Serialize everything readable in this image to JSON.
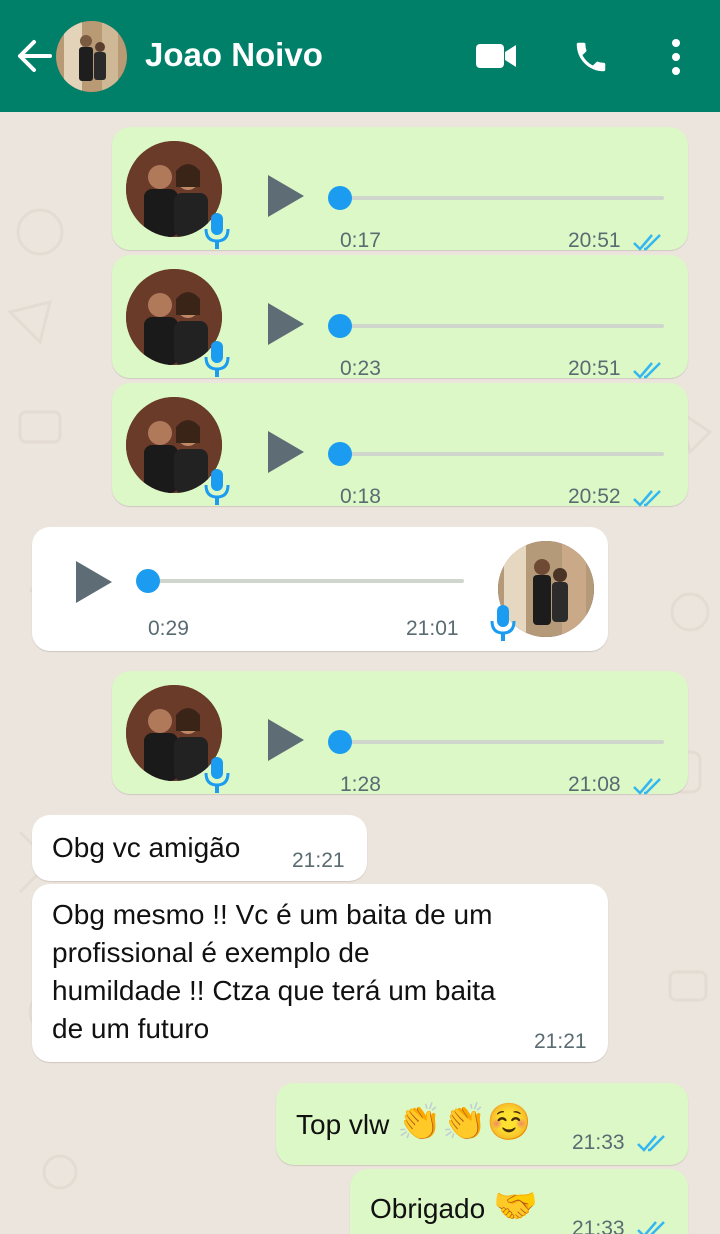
{
  "header": {
    "contact_name": "Joao Noivo",
    "bg_color": "#008069",
    "icons": [
      "back-arrow-icon",
      "video-call-icon",
      "phone-icon",
      "more-options-icon"
    ]
  },
  "messages": [
    {
      "type": "voice",
      "direction": "out",
      "duration": "0:17",
      "time": "20:51",
      "status": "read"
    },
    {
      "type": "voice",
      "direction": "out",
      "duration": "0:23",
      "time": "20:51",
      "status": "read"
    },
    {
      "type": "voice",
      "direction": "out",
      "duration": "0:18",
      "time": "20:52",
      "status": "read"
    },
    {
      "type": "voice",
      "direction": "in",
      "duration": "0:29",
      "time": "21:01"
    },
    {
      "type": "voice",
      "direction": "out",
      "duration": "1:28",
      "time": "21:08",
      "status": "read"
    },
    {
      "type": "text",
      "direction": "in",
      "text": "Obg vc amigão",
      "time": "21:21"
    },
    {
      "type": "text",
      "direction": "in",
      "lines": [
        "Obg mesmo !! Vc é um baita de um",
        "profissional é exemplo de",
        "humildade !! Ctza que terá um baita",
        "de um futuro"
      ],
      "time": "21:21"
    },
    {
      "type": "text",
      "direction": "out",
      "text": "Top vlw",
      "emoji": "👏👏☺️",
      "time": "21:33",
      "status": "read"
    },
    {
      "type": "text",
      "direction": "out",
      "text": "Obrigado",
      "emoji": "🤝",
      "time": "21:33",
      "status": "read"
    }
  ],
  "colors": {
    "outgoing_bubble": "#dcf8c6",
    "incoming_bubble": "#ffffff",
    "read_ticks": "#34b7f1",
    "progress_knob": "#1b9cf0",
    "chat_background": "#ece5dd"
  }
}
